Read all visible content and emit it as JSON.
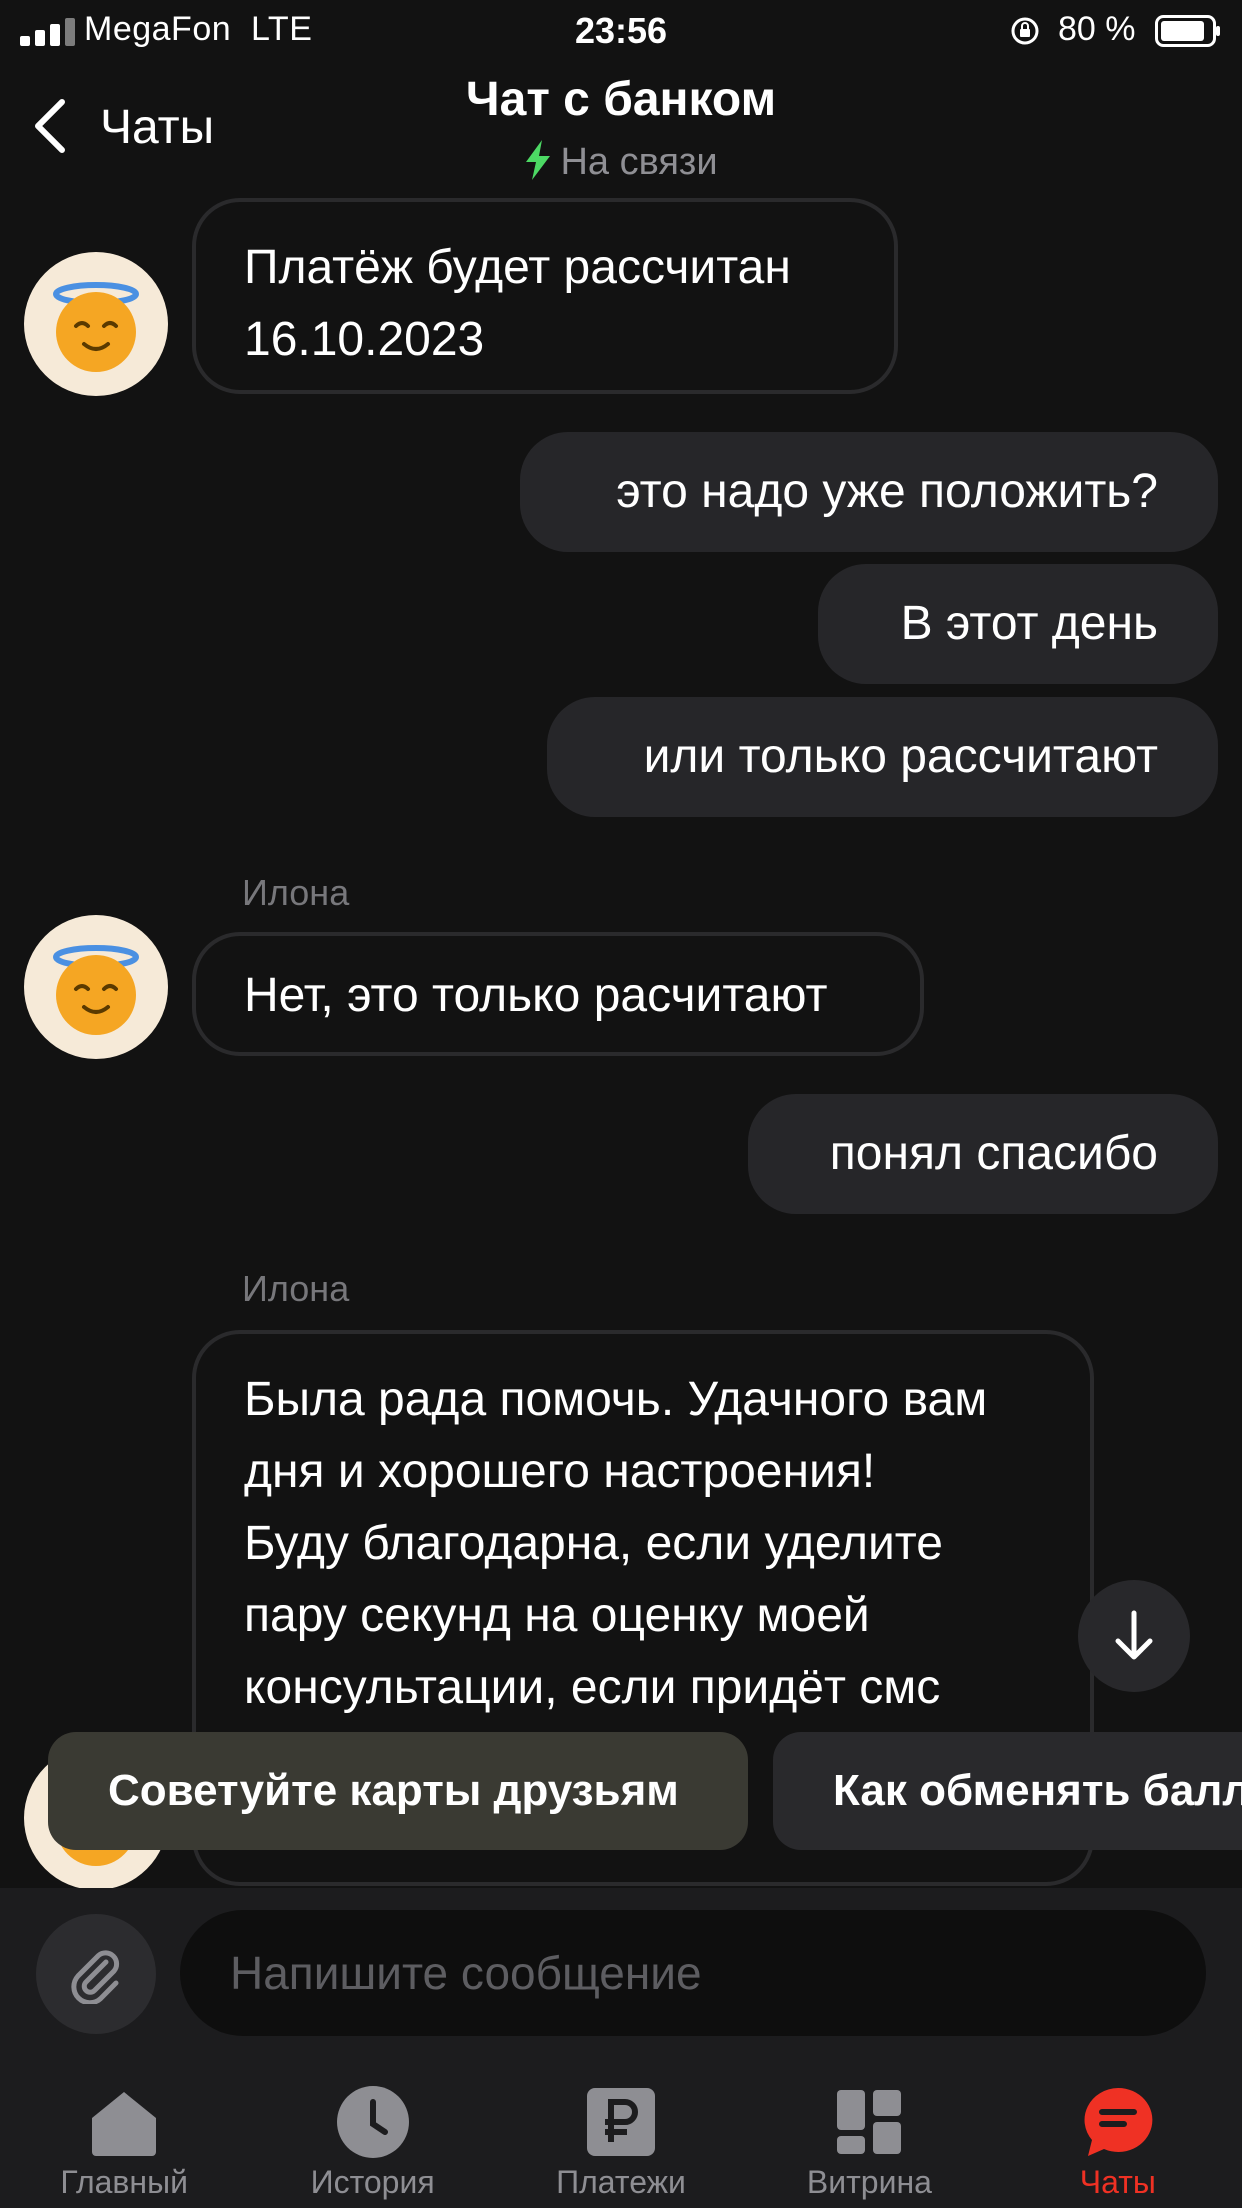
{
  "status_bar": {
    "carrier": "MegaFon",
    "network": "LTE",
    "time": "23:56",
    "battery": "80 %"
  },
  "header": {
    "back_label": "Чаты",
    "title": "Чат с банком",
    "status": "На связи"
  },
  "messages": [
    {
      "direction": "in",
      "text_lines": [
        "Платёж будет рассчитан",
        "16.10.2023"
      ]
    },
    {
      "direction": "out",
      "text": "это надо уже положить?"
    },
    {
      "direction": "out",
      "text": "В этот день"
    },
    {
      "direction": "out",
      "text": "или только рассчитают"
    },
    {
      "direction": "in",
      "sender": "Илона",
      "text": "Нет, это только расчитают"
    },
    {
      "direction": "out",
      "text": "понял спасибо"
    },
    {
      "direction": "in",
      "sender": "Илона",
      "text_lines": [
        "Была рада помочь. Удачного вам",
        "дня и хорошего настроения!",
        "Буду благодарна, если уделите",
        "пару секунд на оценку моей",
        "консультации, если придёт смс"
      ]
    }
  ],
  "suggestions": [
    "Советуйте карты друзьям",
    "Как обменять балл"
  ],
  "composer": {
    "placeholder": "Напишите сообщение"
  },
  "tabs": [
    {
      "label": "Главный",
      "icon": "home-icon",
      "active": false
    },
    {
      "label": "История",
      "icon": "clock-icon",
      "active": false
    },
    {
      "label": "Платежи",
      "icon": "ruble-icon",
      "active": false
    },
    {
      "label": "Витрина",
      "icon": "showcase-icon",
      "active": false
    },
    {
      "label": "Чаты",
      "icon": "chat-icon",
      "active": true
    }
  ],
  "colors": {
    "background": "#121212",
    "accent": "#ef3124",
    "online": "#4cd964"
  }
}
